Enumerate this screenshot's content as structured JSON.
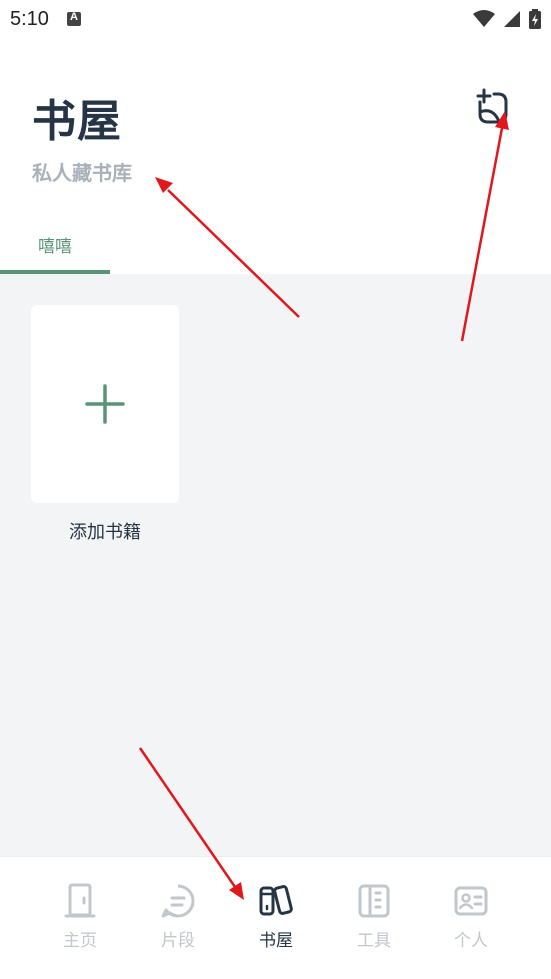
{
  "status_bar": {
    "time": "5:10"
  },
  "header": {
    "title": "书屋",
    "subtitle": "私人藏书库"
  },
  "tabs": [
    {
      "label": "嘻嘻",
      "active": true
    }
  ],
  "content": {
    "add_book_label": "添加书籍"
  },
  "bottom_nav": {
    "items": [
      {
        "label": "主页",
        "icon": "door-icon",
        "active": false
      },
      {
        "label": "片段",
        "icon": "chat-bubble-icon",
        "active": false
      },
      {
        "label": "书屋",
        "icon": "books-icon",
        "active": true
      },
      {
        "label": "工具",
        "icon": "ruler-icon",
        "active": false
      },
      {
        "label": "个人",
        "icon": "profile-card-icon",
        "active": false
      }
    ]
  },
  "colors": {
    "accent": "#5a9477",
    "title": "#263545",
    "subtitle": "#a9b1b9",
    "content_bg": "#f3f4f6",
    "nav_inactive": "#c2c7cc",
    "annotation_arrow": "#e0181b"
  }
}
